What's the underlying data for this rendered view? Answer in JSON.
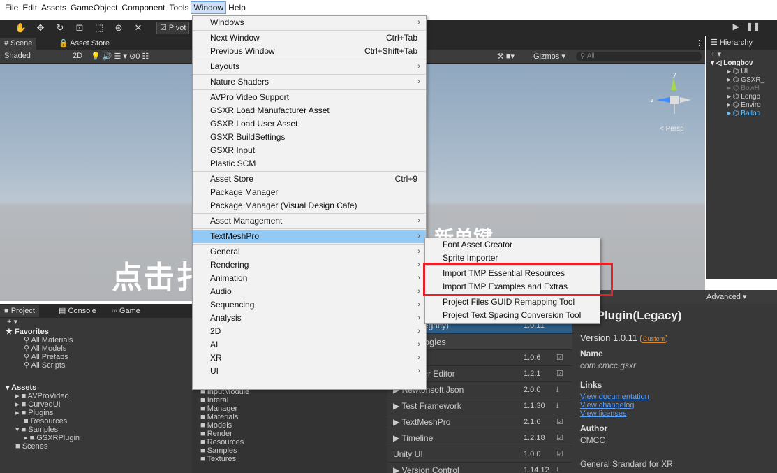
{
  "menubar": {
    "items": [
      "File",
      "Edit",
      "Assets",
      "GameObject",
      "Component",
      "Tools",
      "Window",
      "Help"
    ],
    "active": "Window"
  },
  "toolbar": {
    "pivot_label": "Pivot"
  },
  "scene": {
    "tabs": [
      "# Scene",
      "Asset Store"
    ],
    "shading": "Shaded",
    "mode_2d": "2D",
    "gizmos_label": "Gizmos",
    "search_placeholder": "All",
    "persp_label": "< Persp",
    "overlay_text": "点击扌",
    "overlay_text2": "新单键",
    "gizmo_axes": {
      "y": "y",
      "z": "z"
    }
  },
  "hierarchy": {
    "title": "Hierarchy",
    "add": "+ ▾",
    "rows": [
      {
        "label": "▾ ◁ Longbov",
        "style": "root"
      },
      {
        "label": "▸ ⌬ UI",
        "style": ""
      },
      {
        "label": "▸ ⌬ GSXR_",
        "style": ""
      },
      {
        "label": "▸ ⌬ BowH",
        "style": "dim"
      },
      {
        "label": "▸ ⌬ Longb",
        "style": ""
      },
      {
        "label": "▸ ⌬ Enviro",
        "style": ""
      },
      {
        "label": "▸ ⌬ Balloo",
        "style": "blue"
      }
    ]
  },
  "project": {
    "tabs": [
      "Project",
      "Console",
      "Game"
    ],
    "add": "+ ▾",
    "favorites_header": "★ Favorites",
    "favorites": [
      "All Materials",
      "All Models",
      "All Prefabs",
      "All Scripts"
    ],
    "assets_header": "Assets",
    "assets": [
      {
        "label": "▸ ■ AVProVideo",
        "indent": 1
      },
      {
        "label": "▸ ■ CurvedUI",
        "indent": 1
      },
      {
        "label": "▸ ■ Plugins",
        "indent": 1
      },
      {
        "label": "■ Resources",
        "indent": 2
      },
      {
        "label": "▾ ■ Samples",
        "indent": 1
      },
      {
        "label": "▸ ■ GSXRPlugin",
        "indent": 2
      },
      {
        "label": "■ Scenes",
        "indent": 1
      }
    ],
    "folders": [
      "InputModule",
      "Interal",
      "Manager",
      "Materials",
      "Models",
      "Render",
      "Resources",
      "Samples",
      "Textures"
    ]
  },
  "packages": {
    "rows": [
      {
        "name": "Plugin(Legacy)",
        "version": "1.0.11",
        "icon": "",
        "style": "sel"
      },
      {
        "name": "Technologies",
        "version": "",
        "icon": "",
        "style": "cat"
      },
      {
        "name": "m NUnit",
        "version": "1.0.6",
        "icon": "☑",
        "style": ""
      },
      {
        "name": "ains Rider Editor",
        "version": "1.2.1",
        "icon": "☑",
        "style": ""
      },
      {
        "name": "▶ Newtonsoft Json",
        "version": "2.0.0",
        "icon": "⭳",
        "style": ""
      },
      {
        "name": "▶ Test Framework",
        "version": "1.1.30",
        "icon": "⭳",
        "style": ""
      },
      {
        "name": "▶ TextMeshPro",
        "version": "2.1.6",
        "icon": "☑",
        "style": ""
      },
      {
        "name": "▶ Timeline",
        "version": "1.2.18",
        "icon": "☑",
        "style": ""
      },
      {
        "name": "Unity UI",
        "version": "1.0.0",
        "icon": "☑",
        "style": ""
      },
      {
        "name": "▶ Version Control",
        "version": "1.14.12",
        "icon": "⭳",
        "style": ""
      }
    ]
  },
  "inspector": {
    "advanced_label": "Advanced ▾",
    "title": "XRPlugin(Legacy)",
    "version": "Version 1.0.11",
    "badge": "Custom",
    "name_header": "Name",
    "name_value": "com.cmcc.gsxr",
    "links_header": "Links",
    "links": [
      "View documentation",
      "View changelog",
      "View licenses"
    ],
    "author_header": "Author",
    "author_value": "CMCC",
    "description": "General Srandard for XR"
  },
  "window_menu": {
    "items": [
      {
        "label": "Windows",
        "shortcut": "",
        "submenu": true,
        "sep_after": true
      },
      {
        "label": "Next Window",
        "shortcut": "Ctrl+Tab",
        "submenu": false,
        "sep_after": false
      },
      {
        "label": "Previous Window",
        "shortcut": "Ctrl+Shift+Tab",
        "submenu": false,
        "sep_after": true
      },
      {
        "label": "Layouts",
        "shortcut": "",
        "submenu": true,
        "sep_after": true
      },
      {
        "label": "Nature Shaders",
        "shortcut": "",
        "submenu": true,
        "sep_after": true
      },
      {
        "label": "AVPro Video Support",
        "shortcut": "",
        "submenu": false,
        "sep_after": false
      },
      {
        "label": "GSXR Load Manufacturer Asset",
        "shortcut": "",
        "submenu": false,
        "sep_after": false
      },
      {
        "label": "GSXR Load User Asset",
        "shortcut": "",
        "submenu": false,
        "sep_after": false
      },
      {
        "label": "GSXR BuildSettings",
        "shortcut": "",
        "submenu": false,
        "sep_after": false
      },
      {
        "label": "GSXR Input",
        "shortcut": "",
        "submenu": false,
        "sep_after": false
      },
      {
        "label": "Plastic SCM",
        "shortcut": "",
        "submenu": false,
        "sep_after": true
      },
      {
        "label": "Asset Store",
        "shortcut": "Ctrl+9",
        "submenu": false,
        "sep_after": false
      },
      {
        "label": "Package Manager",
        "shortcut": "",
        "submenu": false,
        "sep_after": false
      },
      {
        "label": "Package Manager (Visual Design Cafe)",
        "shortcut": "",
        "submenu": false,
        "sep_after": true
      },
      {
        "label": "Asset Management",
        "shortcut": "",
        "submenu": true,
        "sep_after": true
      },
      {
        "label": "TextMeshPro",
        "shortcut": "",
        "submenu": true,
        "sep_after": true,
        "highlight": true
      },
      {
        "label": "General",
        "shortcut": "",
        "submenu": true,
        "sep_after": false
      },
      {
        "label": "Rendering",
        "shortcut": "",
        "submenu": true,
        "sep_after": false
      },
      {
        "label": "Animation",
        "shortcut": "",
        "submenu": true,
        "sep_after": false
      },
      {
        "label": "Audio",
        "shortcut": "",
        "submenu": true,
        "sep_after": false
      },
      {
        "label": "Sequencing",
        "shortcut": "",
        "submenu": true,
        "sep_after": false
      },
      {
        "label": "Analysis",
        "shortcut": "",
        "submenu": true,
        "sep_after": false
      },
      {
        "label": "2D",
        "shortcut": "",
        "submenu": true,
        "sep_after": false
      },
      {
        "label": "AI",
        "shortcut": "",
        "submenu": true,
        "sep_after": false
      },
      {
        "label": "XR",
        "shortcut": "",
        "submenu": true,
        "sep_after": false
      },
      {
        "label": "UI",
        "shortcut": "",
        "submenu": true,
        "sep_after": false
      }
    ]
  },
  "tmp_menu": {
    "items": [
      {
        "label": "Font Asset Creator",
        "sep_after": false
      },
      {
        "label": "Sprite Importer",
        "sep_after": true
      },
      {
        "label": "Import TMP Essential Resources",
        "sep_after": false
      },
      {
        "label": "Import TMP Examples and Extras",
        "sep_after": true
      },
      {
        "label": "Project Files GUID Remapping Tool",
        "sep_after": false
      },
      {
        "label": "Project Text Spacing Conversion Tool",
        "sep_after": false
      }
    ]
  },
  "colors": {
    "menu_highlight": "#91c9f7",
    "annotation_box": "#e8202a",
    "unity_dark": "#383838",
    "link_blue": "#5aa0ff",
    "custom_badge": "#e08a2a"
  }
}
